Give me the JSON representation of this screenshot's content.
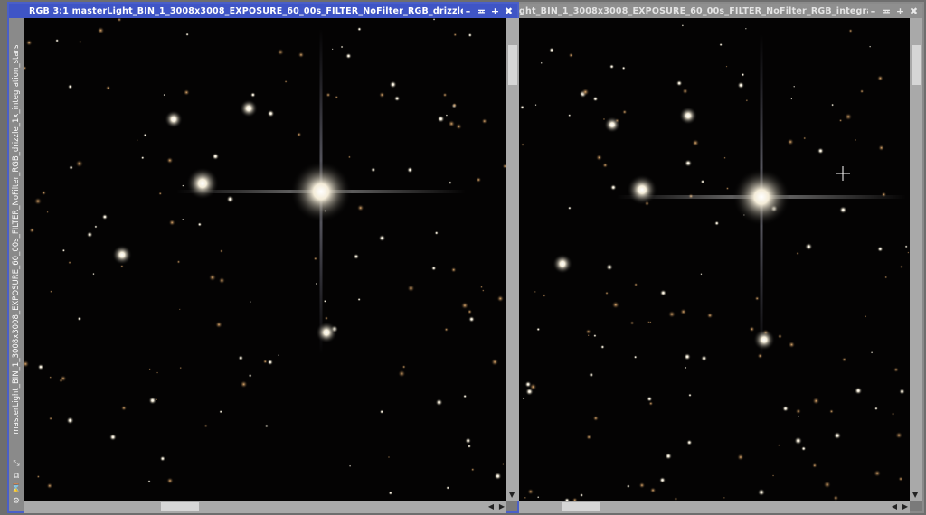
{
  "left_window": {
    "title": "RGB 3:1 masterLight_BIN_1_3008x3008_EXPOSURE_60_00s_FILTER_NoFilter_RGB_drizzle...",
    "side_label": "masterLight_BIN_1_3008x3008_EXPOSURE_60_00s_FILTER_NoFilter_RGB_drizzle_1x_integration_stars",
    "btn_shade": "–",
    "btn_collapse": "≖",
    "btn_maximize": "+",
    "btn_close": "✖"
  },
  "right_window": {
    "title": "ght_BIN_1_3008x3008_EXPOSURE_60_00s_FILTER_NoFilter_RGB_integra...",
    "btn_shade": "–",
    "btn_collapse": "≖",
    "btn_maximize": "+",
    "btn_close": "✖"
  },
  "icons": {
    "resize": "⤡",
    "copy": "⧉",
    "hourglass": "⌛",
    "settings": "⚙"
  },
  "colors": {
    "active_titlebar": "#3f55c6",
    "inactive_titlebar": "#8f8f8f",
    "image_background": "#030303"
  }
}
